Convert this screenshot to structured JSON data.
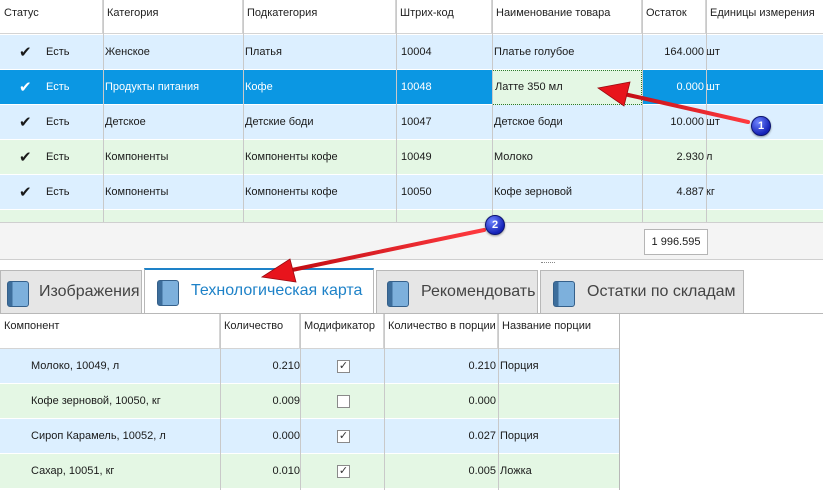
{
  "main_grid": {
    "columns": [
      "Статус",
      "Категория",
      "Подкатегория",
      "Штрих-код",
      "Наименование товара",
      "Остаток",
      "Единицы измерения"
    ],
    "rows": [
      {
        "status": "Есть",
        "category": "Женское",
        "subcategory": "Платья",
        "barcode": "10004",
        "name": "Платье голубое",
        "stock": "164.000",
        "unit": "шт"
      },
      {
        "status": "Есть",
        "category": "Продукты питания",
        "subcategory": "Кофе",
        "barcode": "10048",
        "name": "Латте 350 мл",
        "stock": "0.000",
        "unit": "шт"
      },
      {
        "status": "Есть",
        "category": "Детское",
        "subcategory": "Детские боди",
        "barcode": "10047",
        "name": "Детское боди",
        "stock": "10.000",
        "unit": "шт"
      },
      {
        "status": "Есть",
        "category": "Компоненты",
        "subcategory": "Компоненты кофе",
        "barcode": "10049",
        "name": "Молоко",
        "stock": "2.930",
        "unit": "л"
      },
      {
        "status": "Есть",
        "category": "Компоненты",
        "subcategory": "Компоненты кофе",
        "barcode": "10050",
        "name": "Кофе зерновой",
        "stock": "4.887",
        "unit": "кг"
      }
    ],
    "selected_row": 1,
    "total": "1 996.595"
  },
  "tabs": [
    {
      "label": "Изображения",
      "icon": "book-icon",
      "active": false
    },
    {
      "label": "Технологическая карта",
      "icon": "book-icon",
      "active": true
    },
    {
      "label": "Рекомендовать",
      "icon": "book-icon",
      "active": false
    },
    {
      "label": "Остатки по складам",
      "icon": "book-icon",
      "active": false
    }
  ],
  "components_grid": {
    "columns": [
      "Компонент",
      "Количество",
      "Модификатор",
      "Количество в порции",
      "Название порции"
    ],
    "rows": [
      {
        "component": "Молоко, 10049, л",
        "quantity": "0.210",
        "modifier": true,
        "portion_qty": "0.210",
        "portion_name": "Порция"
      },
      {
        "component": "Кофе зерновой, 10050, кг",
        "quantity": "0.009",
        "modifier": false,
        "portion_qty": "0.000",
        "portion_name": ""
      },
      {
        "component": "Сироп Карамель, 10052, л",
        "quantity": "0.000",
        "modifier": true,
        "portion_qty": "0.027",
        "portion_name": "Порция"
      },
      {
        "component": "Сахар, 10051, кг",
        "quantity": "0.010",
        "modifier": true,
        "portion_qty": "0.005",
        "portion_name": "Ложка"
      }
    ]
  },
  "annotations": [
    "1",
    "2"
  ],
  "colors": {
    "selected_row": "#0b97e3",
    "row_blue": "#dcefff",
    "row_green": "#e4f7e4",
    "arrow": "#e8141c",
    "active_tab_text": "#1e82c8",
    "badge": "#1522b8"
  },
  "icons": {
    "check": "✔",
    "book": "book-icon"
  }
}
